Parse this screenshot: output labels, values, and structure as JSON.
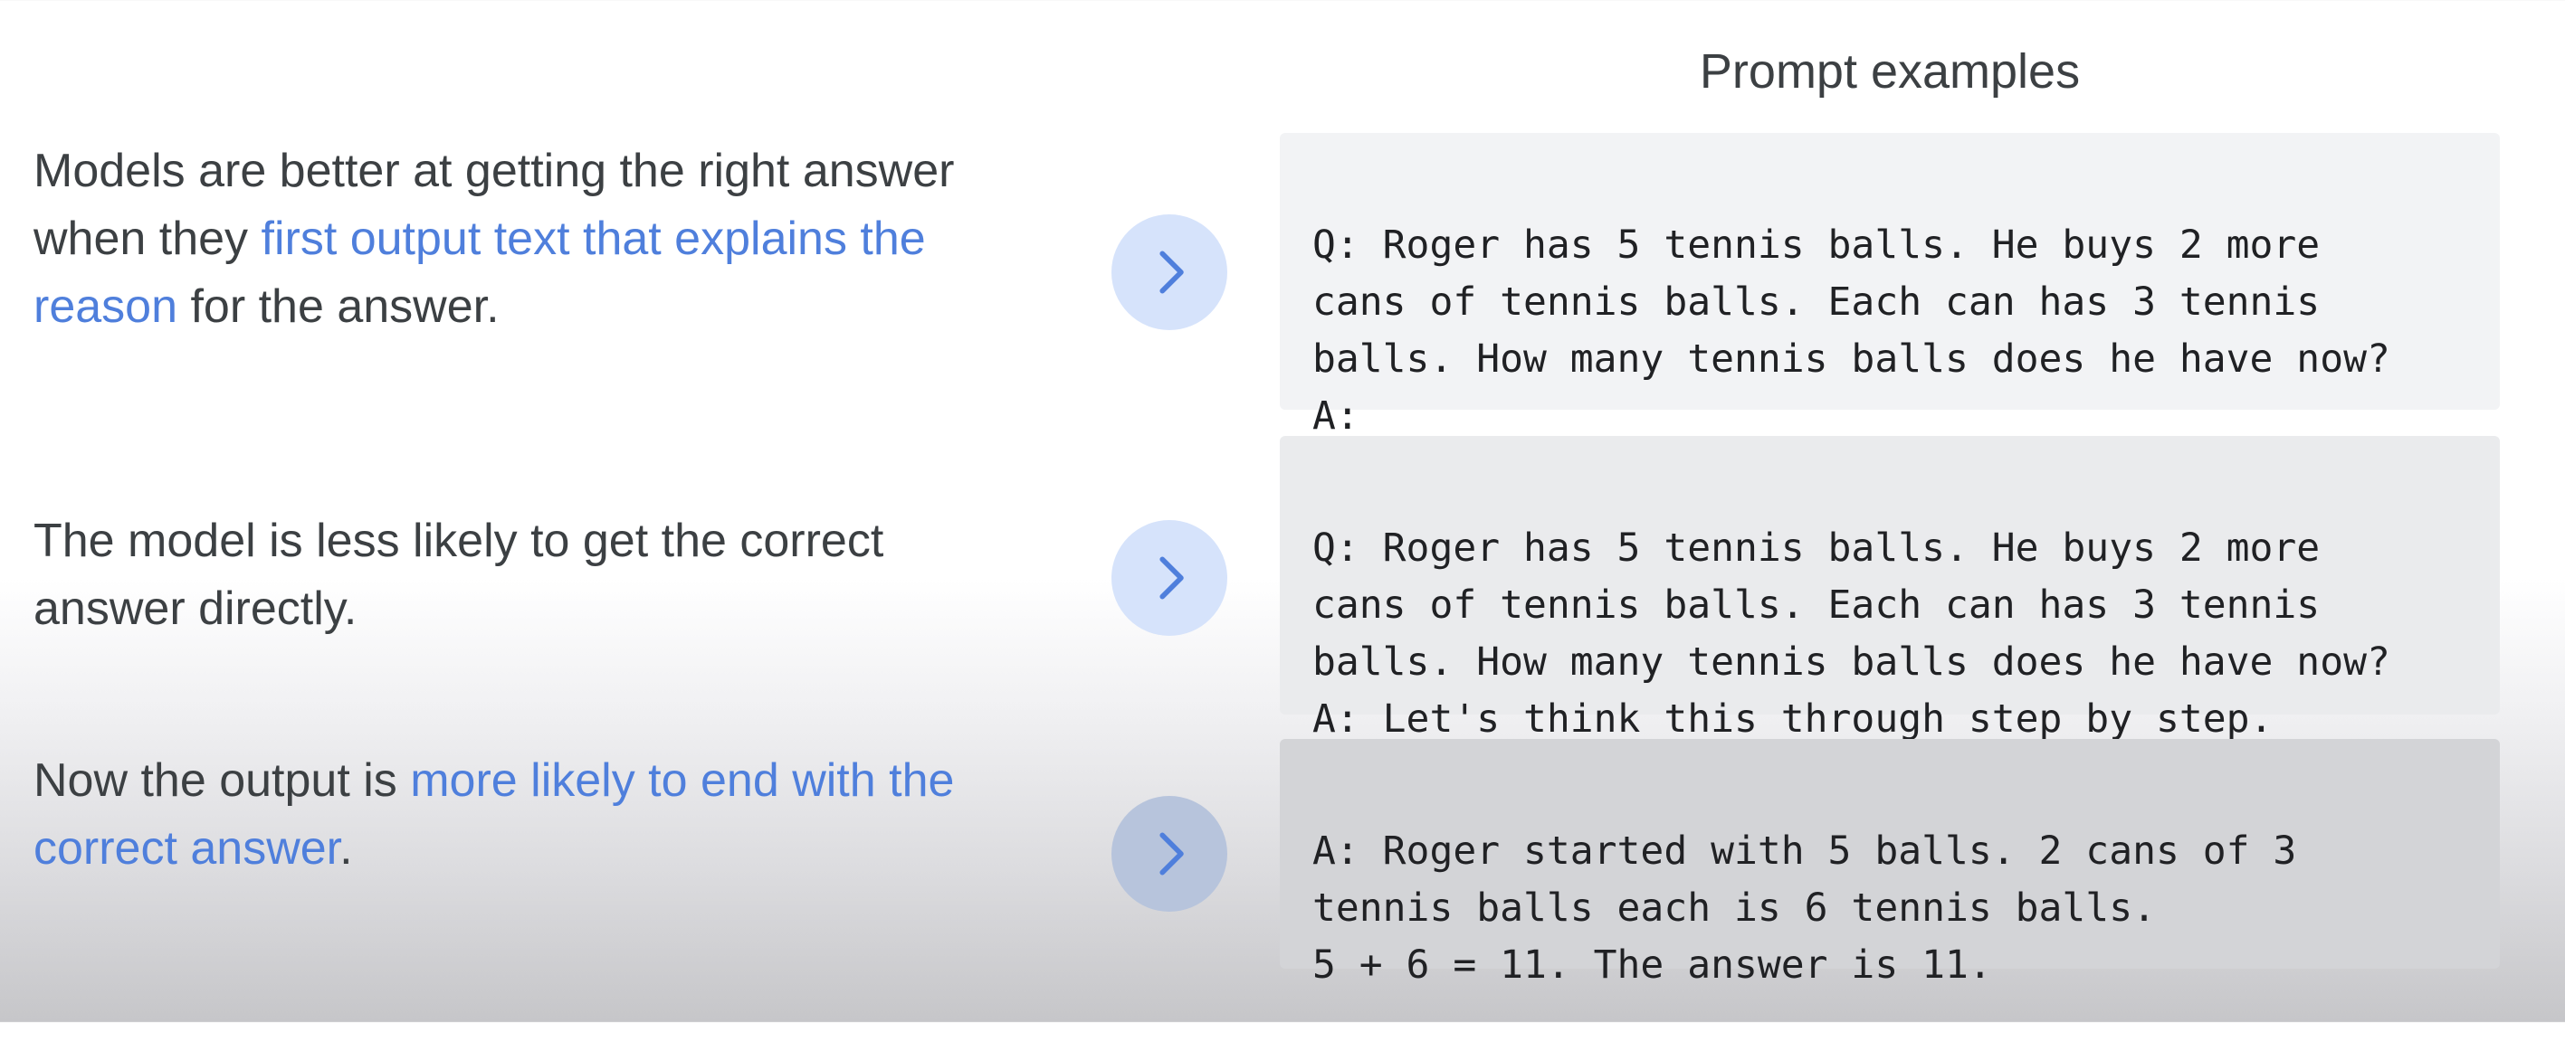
{
  "heading": "Prompt examples",
  "rows": [
    {
      "text_parts": [
        "Models are better at getting the right answer when they ",
        "first output text that explains the reason",
        " for the answer."
      ],
      "prompt_lines": [
        "Q: Roger has 5 tennis balls. He buys 2 more",
        "cans of tennis balls. Each can has 3 tennis",
        "balls. How many tennis balls does he have now?",
        "A:"
      ]
    },
    {
      "text_parts": [
        "The model is less likely to get the correct answer directly."
      ],
      "prompt_lines": [
        "Q: Roger has 5 tennis balls. He buys 2 more",
        "cans of tennis balls. Each can has 3 tennis",
        "balls. How many tennis balls does he have now?",
        "A: Let's think this through step by step."
      ]
    },
    {
      "text_parts": [
        "Now the output is ",
        "more likely to end with the correct answer",
        "."
      ],
      "prompt_lines": [
        "A: Roger started with 5 balls. 2 cans of 3",
        "tennis balls each is 6 tennis balls.",
        "5 + 6 = 11. The answer is 11."
      ]
    }
  ],
  "colors": {
    "text": "#3c4043",
    "highlight": "#4f7fdc",
    "arrow_circle": "#d6e3fb",
    "arrow_chevron": "#4f7fdc",
    "prompt_box": "#f2f3f5"
  },
  "icons": {
    "arrow": "chevron-right-icon"
  }
}
